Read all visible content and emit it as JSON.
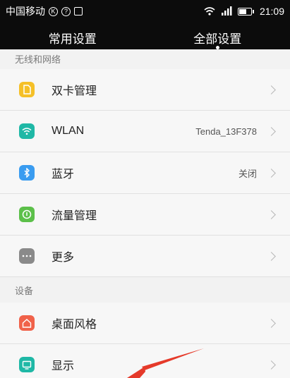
{
  "status_bar": {
    "carrier": "中国移动",
    "time": "21:09"
  },
  "tabs": [
    {
      "label": "常用设置",
      "active": false
    },
    {
      "label": "全部设置",
      "active": true
    }
  ],
  "sections": [
    {
      "header": "无线和网络",
      "items": [
        {
          "label": "双卡管理",
          "value": "",
          "icon": "sim-card-icon",
          "color": "#f5c028"
        },
        {
          "label": "WLAN",
          "value": "Tenda_13F378",
          "icon": "wifi-icon",
          "color": "#1fb8a6"
        },
        {
          "label": "蓝牙",
          "value": "关闭",
          "icon": "bluetooth-icon",
          "color": "#3a9cf0"
        },
        {
          "label": "流量管理",
          "value": "",
          "icon": "data-usage-icon",
          "color": "#5cc04a"
        },
        {
          "label": "更多",
          "value": "",
          "icon": "more-icon",
          "color": "#8a8a8a"
        }
      ]
    },
    {
      "header": "设备",
      "items": [
        {
          "label": "桌面风格",
          "value": "",
          "icon": "home-icon",
          "color": "#f0624a"
        },
        {
          "label": "显示",
          "value": "",
          "icon": "display-icon",
          "color": "#1fb8a6"
        }
      ]
    }
  ],
  "colors": {
    "annotation_arrow": "#e53a2a"
  }
}
